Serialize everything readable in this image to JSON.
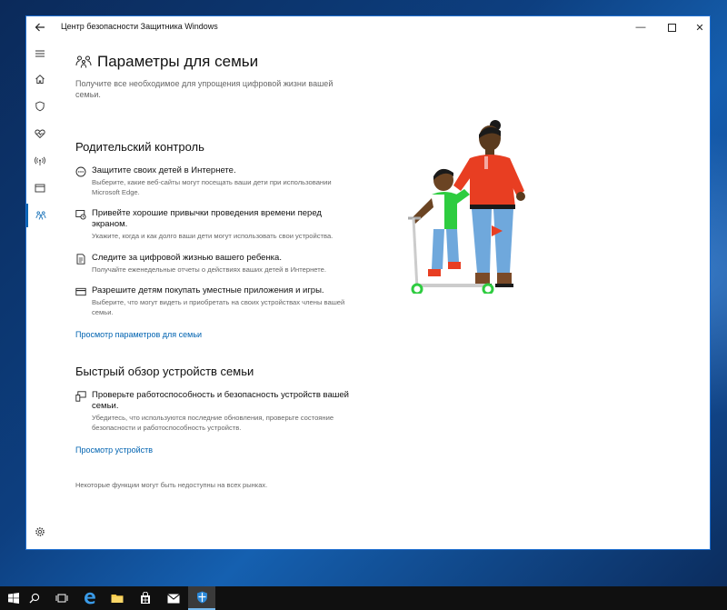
{
  "window": {
    "title": "Центр безопасности Защитника Windows",
    "back_icon": "arrow-left-icon",
    "min_glyph": "—",
    "max_glyph": "☐",
    "close_glyph": "✕"
  },
  "sidebar": {
    "items": [
      {
        "icon": "hamburger-menu-icon"
      },
      {
        "icon": "home-icon"
      },
      {
        "icon": "shield-icon"
      },
      {
        "icon": "heart-pulse-icon"
      },
      {
        "icon": "wifi-antenna-icon"
      },
      {
        "icon": "app-browser-icon"
      },
      {
        "icon": "family-icon",
        "active": true
      },
      {
        "icon": "settings-gear-icon"
      }
    ]
  },
  "page": {
    "title": "Параметры для семьи",
    "subtitle": "Получите все необходимое для упрощения цифровой жизни вашей семьи."
  },
  "parental": {
    "heading": "Родительский контроль",
    "features": [
      {
        "icon": "browser-dots-icon",
        "title": "Защитите своих детей в Интернете.",
        "desc": "Выберите, какие веб-сайты могут посещать ваши дети при использовании Microsoft Edge."
      },
      {
        "icon": "screen-time-icon",
        "title": "Привейте хорошие привычки проведения времени перед экраном.",
        "desc": "Укажите, когда и как долго ваши дети могут использовать свои устройства."
      },
      {
        "icon": "report-icon",
        "title": "Следите за цифровой жизнью вашего ребенка.",
        "desc": "Получайте еженедельные отчеты о действиях ваших детей в Интернете."
      },
      {
        "icon": "credit-card-icon",
        "title": "Разрешите детям покупать уместные приложения и игры.",
        "desc": "Выберите, что могут видеть и приобретать на своих устройствах члены вашей семьи."
      }
    ],
    "link": "Просмотр параметров для семьи"
  },
  "devices": {
    "heading": "Быстрый обзор устройств семьи",
    "feature": {
      "icon": "devices-icon",
      "title": "Проверьте работоспособность и безопасность устройств вашей семьи.",
      "desc": "Убедитесь, что используются последние обновления, проверьте состояние безопасности и работоспособность устройств."
    },
    "link": "Просмотр устройств"
  },
  "footnote": "Некоторые функции могут быть недоступны на всех рынках.",
  "taskbar": {
    "items": [
      {
        "icon": "windows-start-icon"
      },
      {
        "icon": "search-icon"
      },
      {
        "icon": "task-view-icon"
      },
      {
        "icon": "edge-browser-icon"
      },
      {
        "icon": "file-explorer-icon"
      },
      {
        "icon": "store-icon"
      },
      {
        "icon": "mail-icon"
      },
      {
        "icon": "defender-shield-icon",
        "active": true
      }
    ]
  },
  "colors": {
    "accent": "#0063b1",
    "desktop": "#0d3f80",
    "taskbar": "#101010"
  }
}
